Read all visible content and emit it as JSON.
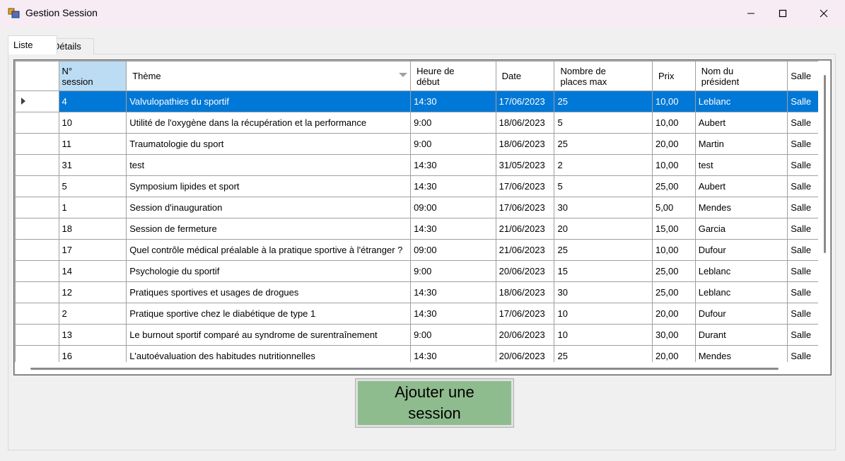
{
  "window": {
    "title": "Gestion Session"
  },
  "tabs": [
    {
      "label": "Liste"
    },
    {
      "label": "Détails"
    }
  ],
  "grid": {
    "columns": [
      {
        "label": "N° session"
      },
      {
        "label": "Thème"
      },
      {
        "label": "Heure de début"
      },
      {
        "label": "Date"
      },
      {
        "label": "Nombre de places max"
      },
      {
        "label": "Prix"
      },
      {
        "label": "Nom du président"
      },
      {
        "label": "Salle"
      }
    ],
    "rows": [
      [
        "4",
        "Valvulopathies du sportif",
        "14:30",
        "17/06/2023",
        "25",
        "10,00",
        "Leblanc",
        "Salle"
      ],
      [
        "10",
        "Utilité de l'oxygène dans la récupération et la performance",
        "9:00",
        "18/06/2023",
        "5",
        "10,00",
        "Aubert",
        "Salle"
      ],
      [
        "11",
        "Traumatologie du sport",
        "9:00",
        "18/06/2023",
        "25",
        "20,00",
        "Martin",
        "Salle"
      ],
      [
        "31",
        "test",
        "14:30",
        "31/05/2023",
        "2",
        "10,00",
        "test",
        "Salle"
      ],
      [
        "5",
        "Symposium lipides et sport",
        "14:30",
        "17/06/2023",
        "5",
        "25,00",
        "Aubert",
        "Salle"
      ],
      [
        "1",
        "Session d'inauguration",
        "09:00",
        "17/06/2023",
        "30",
        "5,00",
        "Mendes",
        "Salle"
      ],
      [
        "18",
        "Session de fermeture",
        "14:30",
        "21/06/2023",
        "20",
        "15,00",
        "Garcia",
        "Salle"
      ],
      [
        "17",
        "Quel contrôle médical préalable à la pratique sportive à l'étranger ?",
        "09:00",
        "21/06/2023",
        "25",
        "10,00",
        "Dufour",
        "Salle"
      ],
      [
        "14",
        "Psychologie du sportif",
        "9:00",
        "20/06/2023",
        "15",
        "25,00",
        "Leblanc",
        "Salle"
      ],
      [
        "12",
        "Pratiques sportives et usages de drogues",
        "14:30",
        "18/06/2023",
        "30",
        "25,00",
        "Leblanc",
        "Salle"
      ],
      [
        "2",
        "Pratique sportive chez le diabétique de type 1",
        "14:30",
        "17/06/2023",
        "10",
        "20,00",
        "Dufour",
        "Salle"
      ],
      [
        "13",
        "Le burnout sportif comparé au syndrome de surentraînement",
        "9:00",
        "20/06/2023",
        "10",
        "30,00",
        "Durant",
        "Salle"
      ],
      [
        "16",
        "L'autoévaluation des habitudes nutritionnelles",
        "14:30",
        "20/06/2023",
        "25",
        "20,00",
        "Mendes",
        "Salle"
      ]
    ],
    "selected_row": 0
  },
  "buttons": {
    "add_session": "Ajouter une session"
  },
  "colors": {
    "selection": "#0078d7",
    "header_selected": "#bcdcf4",
    "add_button": "#8fbc8f"
  }
}
